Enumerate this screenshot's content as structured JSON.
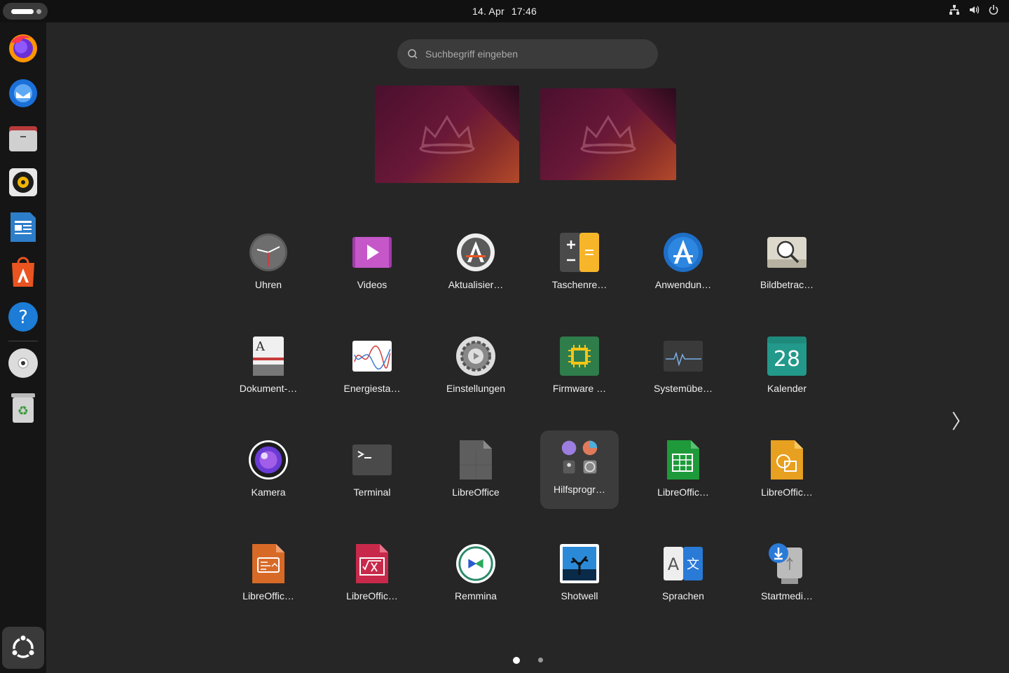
{
  "topbar": {
    "date": "14. Apr",
    "time": "17:46",
    "tray_icons": [
      "network-icon",
      "volume-icon",
      "power-icon"
    ]
  },
  "dock": {
    "items": [
      "firefox-icon",
      "thunderbird-icon",
      "files-icon",
      "rhythmbox-icon",
      "libreoffice-writer-icon",
      "app-center-icon",
      "help-icon",
      "disc-icon",
      "trash-icon"
    ],
    "show_apps": "show-apps-icon"
  },
  "search": {
    "placeholder": "Suchbegriff eingeben"
  },
  "apps": {
    "row1": [
      "Uhren",
      "Videos",
      "Aktualisier…",
      "Taschenre…",
      "Anwendun…",
      "Bildbetrac…"
    ],
    "row2": [
      "Dokument-…",
      "Energiesta…",
      "Einstellungen",
      "Firmware …",
      "Systemübe…",
      "Kalender"
    ],
    "row3": [
      "Kamera",
      "Terminal",
      "LibreOffice",
      "Hilfsprogr…",
      "LibreOffic…",
      "LibreOffic…"
    ],
    "row4": [
      "LibreOffic…",
      "LibreOffic…",
      "Remmina",
      "Shotwell",
      "Sprachen",
      "Startmedi…"
    ]
  },
  "calendar_day": "28",
  "pager": {
    "pages": 2,
    "current": 1
  },
  "colors": {
    "accent_orange": "#e95420",
    "panel": "#262626",
    "selected": "#3c3c3c"
  }
}
